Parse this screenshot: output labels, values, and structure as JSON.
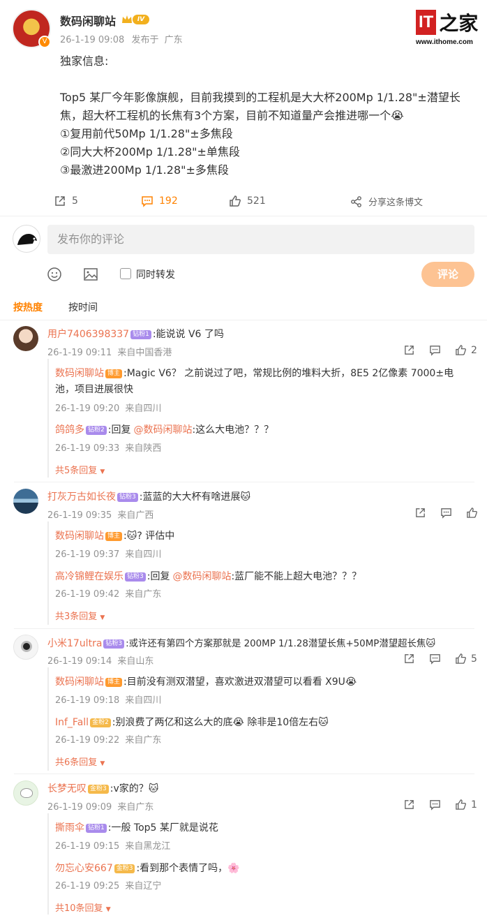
{
  "post": {
    "author": "数码闲聊站",
    "level_badge": "IV",
    "time": "26-1-19 09:08",
    "location_prefix": "发布于",
    "location": "广东",
    "body": [
      "独家信息:",
      "",
      "Top5 某厂今年影像旗舰，目前我摸到的工程机是大大杯200Mp 1/1.28\"±潜望长",
      "焦，超大杯工程机的长焦有3个方案，目前不知道量产会推进哪一个😭",
      "①复用前代50Mp 1/1.28\"±多焦段",
      "②同大大杯200Mp 1/1.28\"±单焦段",
      "③最激进200Mp 1/1.28\"±多焦段"
    ],
    "repost_count": "5",
    "comment_count": "192",
    "like_count": "521",
    "share_label": "分享这条博文"
  },
  "watermark": {
    "logo": "IT之家",
    "url": "www.ithome.com"
  },
  "composer": {
    "placeholder": "发布你的评论",
    "repost_label": "同时转发",
    "submit_label": "评论"
  },
  "sort": {
    "hot": "按热度",
    "time": "按时间"
  },
  "comments": [
    {
      "user": "用户7406398337",
      "badge": "钻粉1",
      "text": ":能说说 V6 了吗",
      "time": "26-1-19 09:11",
      "loc": "来自中国香港",
      "likes": "2",
      "replies": [
        {
          "user": "数码闲聊站",
          "badge": "博主",
          "text": ":Magic V6？ 之前说过了吧，常规比例的堆料大折，8E5 2亿像素 7000±电",
          "text2": "池，项目进展很快",
          "time": "26-1-19 09:20",
          "loc": "来自四川"
        },
        {
          "user": "鸽鸽多",
          "badge": "钻粉2",
          "prefix": ":回复",
          "mention": "@数码闲聊站",
          "text": ":这么大电池？？？",
          "time": "26-1-19 09:33",
          "loc": "来自陕西"
        }
      ],
      "more": "共5条回复"
    },
    {
      "user": "打灰万古如长夜",
      "badge": "钻粉3",
      "text": ":蓝蓝的大大杯有啥进展🐱",
      "time": "26-1-19 09:35",
      "loc": "来自广西",
      "likes": "",
      "replies": [
        {
          "user": "数码闲聊站",
          "badge": "博主",
          "text": ":🐱? 评估中",
          "time": "26-1-19 09:37",
          "loc": "来自四川"
        },
        {
          "user": "高冷锦鲤在娱乐",
          "badge": "钻粉3",
          "prefix": ":回复",
          "mention": "@数码闲聊站",
          "text": ":蓝厂能不能上超大电池？？？",
          "time": "26-1-19 09:42",
          "loc": "来自广东"
        }
      ],
      "more": "共3条回复"
    },
    {
      "user": "小米17ultra",
      "badge": "钻粉3",
      "text": ":或许还有第四个方案那就是 200MP 1/1.28潜望长焦+50MP潜望超长焦🐱",
      "time": "26-1-19 09:14",
      "loc": "来自山东",
      "likes": "5",
      "replies": [
        {
          "user": "数码闲聊站",
          "badge": "博主",
          "text": ":目前没有测双潜望，喜欢激进双潜望可以看看 X9U😭",
          "time": "26-1-19 09:18",
          "loc": "来自四川"
        },
        {
          "user": "Inf_Fall",
          "badge": "金粉2",
          "text": ":别浪费了两亿和这么大的底😭 除非是10倍左右🐱",
          "time": "26-1-19 09:22",
          "loc": "来自广东"
        }
      ],
      "more": "共6条回复"
    },
    {
      "user": "长梦无叹",
      "badge": "金粉3",
      "text": ":v家的？🐱",
      "time": "26-1-19 09:09",
      "loc": "来自广东",
      "likes": "1",
      "replies": [
        {
          "user": "撕雨伞",
          "badge": "钻粉1",
          "text": ":一般 Top5 某厂就是说花",
          "time": "26-1-19 09:15",
          "loc": "来自黑龙江"
        },
        {
          "user": "勿忘心安667",
          "badge": "金粉3",
          "text": ":看到那个表情了吗，🌸",
          "time": "26-1-19 09:25",
          "loc": "来自辽宁"
        }
      ],
      "more": "共10条回复"
    }
  ],
  "colors": {
    "accent": "#ff8200",
    "username": "#eb7350",
    "submit": "#fdc393"
  }
}
